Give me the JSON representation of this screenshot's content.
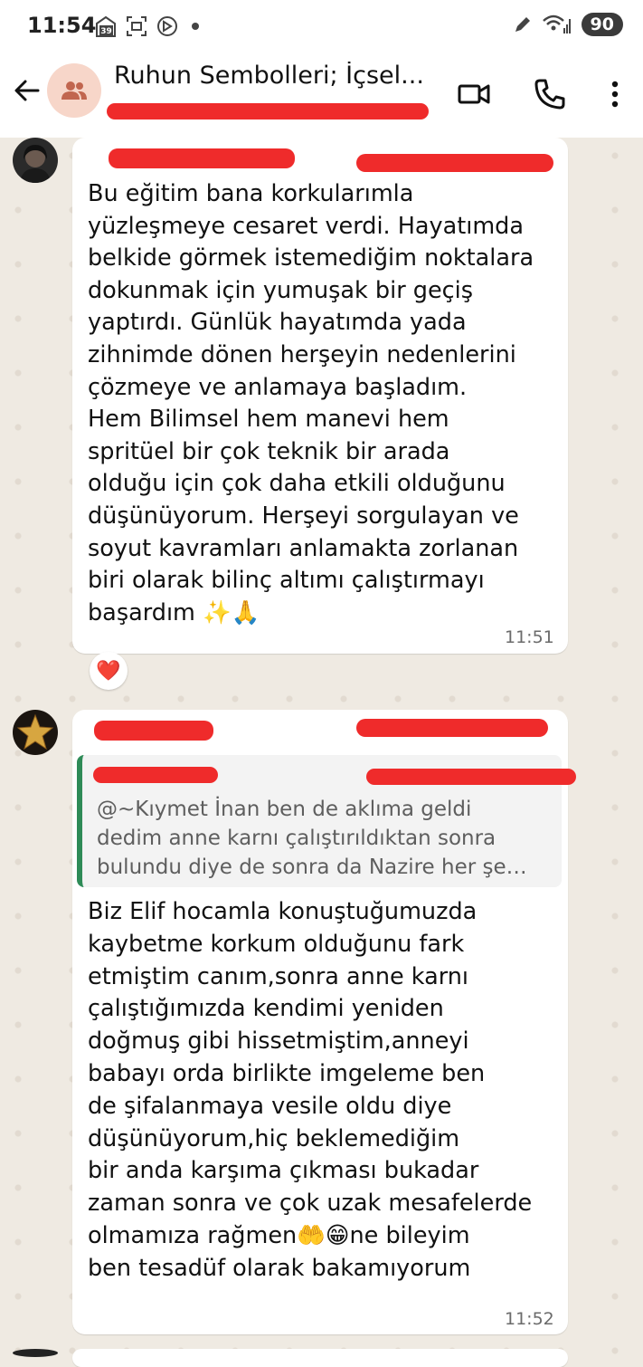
{
  "status_bar": {
    "time": "11:54",
    "notif_count": "39",
    "battery": "90"
  },
  "app_bar": {
    "title": "Ruhun Sembolleri; İçsel..."
  },
  "messages": [
    {
      "text": "Bu eğitim bana korkularımla\nyüzleşmeye cesaret verdi. Hayatımda\nbelkide görmek istemediğim noktalara\ndokunmak için yumuşak bir geçiş\nyaptırdı. Günlük hayatımda yada\nzihnimde dönen herşeyin nedenlerini\nçözmeye ve anlamaya başladım.\nHem Bilimsel hem manevi hem\nspritüel bir çok teknik bir arada\nolduğu için çok daha etkili olduğunu\ndüşünüyorum. Herşeyi sorgulayan ve\nsoyut kavramları anlamakta zorlanan\nbiri olarak bilinç altımı çalıştırmayı\nbaşardım ✨🙏",
      "time": "11:51",
      "reaction": "❤️"
    },
    {
      "quote": "@~Kıymet İnan ben de aklıma geldi\ndedim anne karnı çalıştırıldıktan sonra\nbulundu diye de sonra da Nazire her şe…",
      "text": "Biz Elif hocamla konuştuğumuzda\nkaybetme korkum olduğunu fark\netmiştim canım,sonra anne karnı\nçalıştığımızda kendimi yeniden\ndoğmuş gibi hissetmiştim,anneyi\nbabayı orda birlikte imgeleme ben\nde şifalanmaya vesile oldu diye\ndüşünüyorum,hiç beklemediğim\nbir anda karşıma çıkması bukadar\nzaman sonra ve çok uzak mesafelerde\nolmamıza rağmen🤲😁ne bileyim\nben tesadüf olarak bakamıyorum",
      "time": "11:52"
    }
  ]
}
